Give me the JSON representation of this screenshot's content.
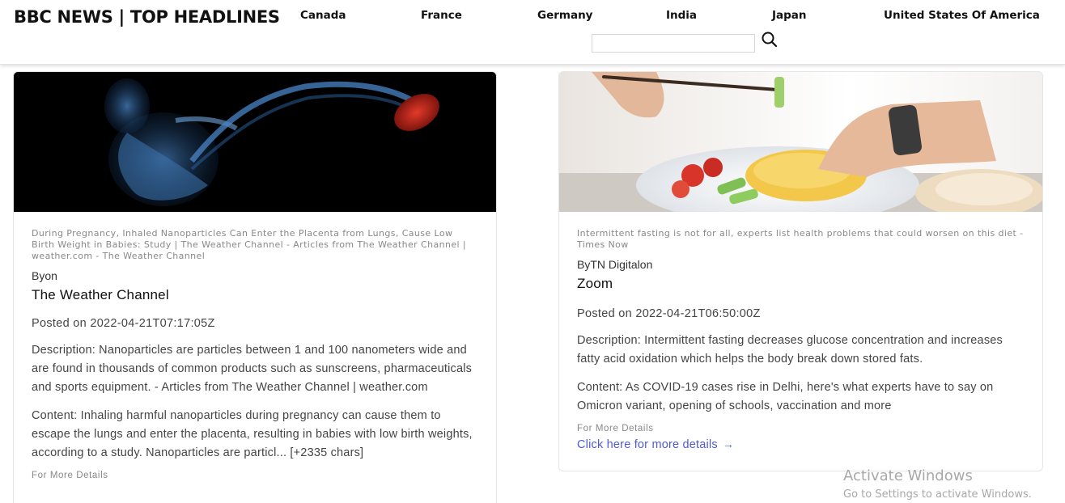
{
  "header": {
    "brand": "BBC NEWS | TOP HEADLINES",
    "nav": [
      "Canada",
      "France",
      "Germany",
      "India",
      "Japan",
      "United States Of America"
    ],
    "search": {
      "value": "",
      "placeholder": ""
    }
  },
  "articles": [
    {
      "title": "During Pregnancy, Inhaled Nanoparticles Can Enter the Placenta from Lungs, Cause Low Birth Weight in Babies: Study | The Weather Channel - Articles from The Weather Channel | weather.com - The Weather Channel",
      "by": "Byon",
      "source": "The Weather Channel",
      "posted": "Posted on 2022-04-21T07:17:05Z",
      "description": "Description: Nanoparticles are particles between 1 and 100 nanometers wide and are found in thousands of common products such as sunscreens, pharmaceuticals and sports equipment. - Articles from The Weather Channel | weather.com",
      "content": "Content: Inhaling harmful nanoparticles during pregnancy can cause them to escape the lungs and enter the placenta, resulting in babies with low birth weights, according to a study. Nanoparticles are particl... [+2335 chars]",
      "more_label": "For More Details"
    },
    {
      "title": "Intermittent fasting is not for all, experts list health problems that could worsen on this diet - Times Now",
      "by": "ByTN Digitalon",
      "source": "Zoom",
      "posted": "Posted on 2022-04-21T06:50:00Z",
      "description": "Description: Intermittent fasting decreases glucose concentration and increases fatty acid oxidation which helps the body break down stored fats.",
      "content": "Content: As COVID-19 cases rise in Delhi, here's what experts have to say on Omicron variant, opening of schools, vaccination and more",
      "more_label": "For More Details",
      "more_link": "Click here for more details"
    }
  ],
  "watermark": {
    "line1": "Activate Windows",
    "line2": "Go to Settings to activate Windows."
  },
  "colors": {
    "link": "#4f5bd5",
    "muted": "#888888",
    "text": "#444444"
  },
  "icons": [
    "search-icon",
    "arrow-right-icon"
  ]
}
